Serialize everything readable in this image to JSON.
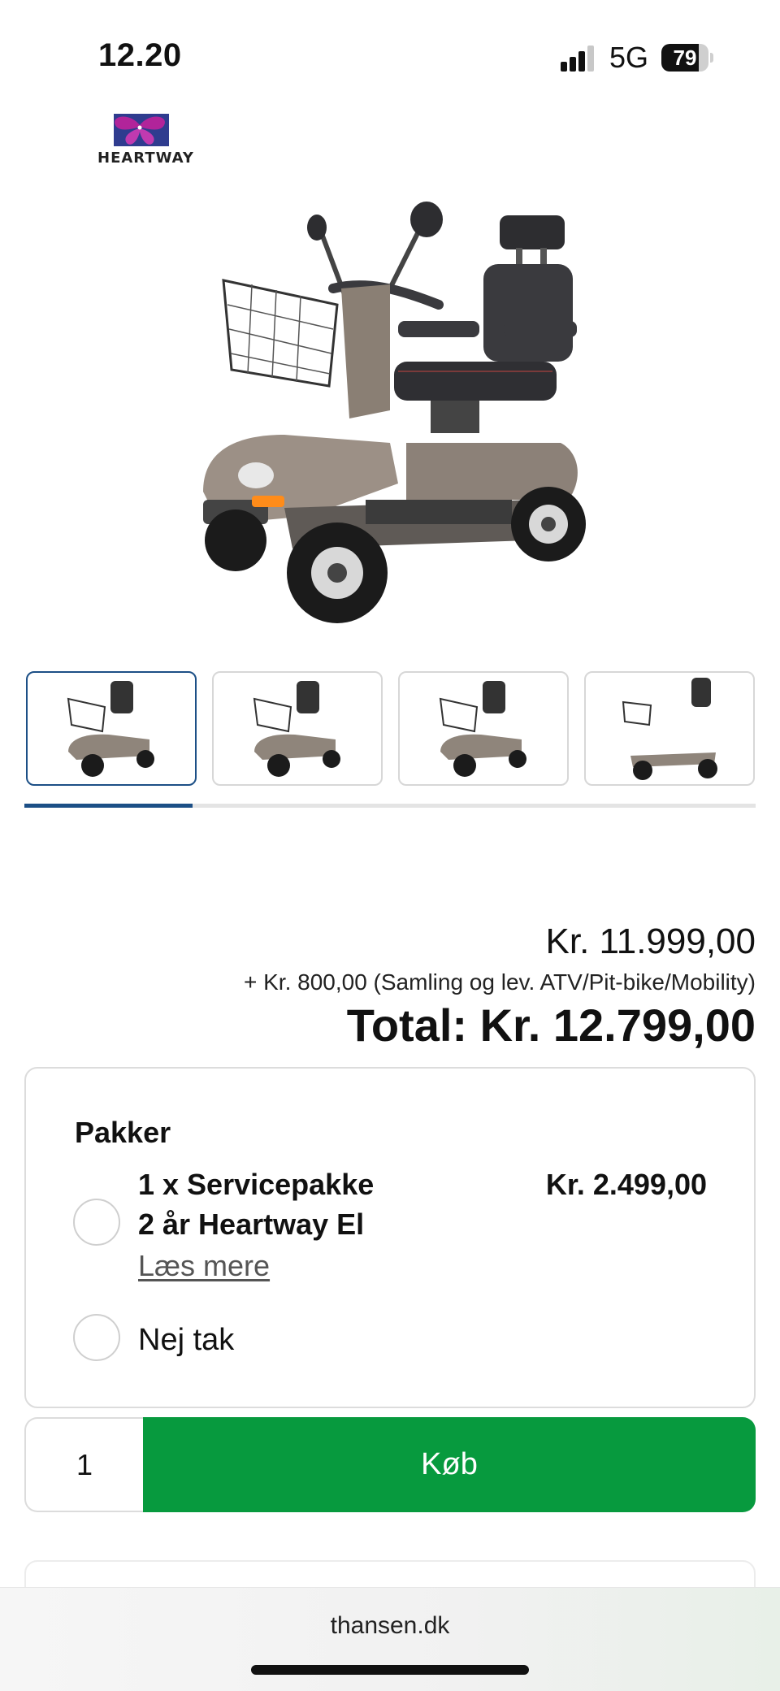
{
  "status_bar": {
    "time": "12.20",
    "network": "5G",
    "battery": "79",
    "battery_level": 0.79
  },
  "brand": {
    "name": "HEARTWAY",
    "logo_icon": "heartway-butterfly-logo",
    "logo_colors": [
      "#a0208f",
      "#2f3c8f"
    ]
  },
  "gallery": {
    "main_image": "mobility-scooter-image",
    "thumbnails": [
      {
        "label": "thumbnail-1",
        "active": true
      },
      {
        "label": "thumbnail-2",
        "active": false
      },
      {
        "label": "thumbnail-3",
        "active": false
      },
      {
        "label": "thumbnail-4",
        "active": false
      }
    ],
    "progress": 0.23
  },
  "pricing": {
    "price": "Kr. 11.999,00",
    "extra": "+ Kr. 800,00 (Samling og lev. ATV/Pit-bike/Mobility)",
    "total": "Total: Kr. 12.799,00"
  },
  "packages": {
    "title": "Pakker",
    "options": [
      {
        "name_line1": "1 x Servicepakke",
        "name_line2": "2 år Heartway El",
        "price": "Kr. 2.499,00",
        "read_more": "Læs mere",
        "selected": false
      },
      {
        "name": "Nej tak",
        "selected": false
      }
    ]
  },
  "buy": {
    "quantity": "1",
    "button_label": "Køb",
    "button_color": "#079a3e"
  },
  "browser": {
    "url": "thansen.dk"
  },
  "colors": {
    "accent": "#1c4f86",
    "buy_green": "#079a3e"
  }
}
